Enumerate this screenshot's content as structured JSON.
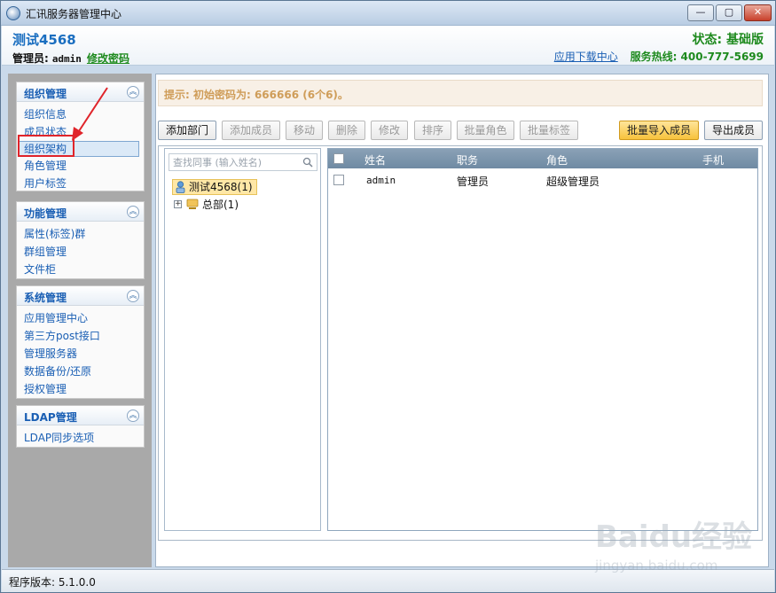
{
  "window": {
    "title": "汇讯服务器管理中心",
    "min_glyph": "—",
    "max_glyph": "▢",
    "close_glyph": "✕"
  },
  "header": {
    "org_name": "测试4568",
    "admin_label": "管理员:",
    "admin_name": "admin",
    "change_password": "修改密码",
    "status": "状态: 基础版",
    "download": "应用下载中心",
    "hotline": "服务热线: 400-777-5699"
  },
  "sidebar": {
    "panels": [
      {
        "title": "组织管理",
        "items": [
          "组织信息",
          "成员状态",
          "组织架构",
          "角色管理",
          "用户标签"
        ]
      },
      {
        "title": "功能管理",
        "items": [
          "属性(标签)群",
          "群组管理",
          "文件柜"
        ]
      },
      {
        "title": "系统管理",
        "items": [
          "应用管理中心",
          "第三方post接口",
          "管理服务器",
          "数据备份/还原",
          "授权管理"
        ]
      },
      {
        "title": "LDAP管理",
        "items": [
          "LDAP同步选项"
        ]
      }
    ],
    "collapse_glyph": "︽",
    "active_item": "组织架构"
  },
  "main": {
    "hint": "提示: 初始密码为: 666666 (6个6)。",
    "toolbar": {
      "add_dept": "添加部门",
      "add_member": "添加成员",
      "move": "移动",
      "delete": "删除",
      "edit": "修改",
      "sort": "排序",
      "batch_role": "批量角色",
      "batch_tag": "批量标签",
      "batch_import": "批量导入成员",
      "export": "导出成员"
    },
    "search": {
      "placeholder": "查找同事 (输入姓名)"
    },
    "tree": {
      "root": "测试4568(1)",
      "child": "总部(1)",
      "expand_glyph": "+"
    },
    "table": {
      "columns": [
        "姓名",
        "职务",
        "角色",
        "手机"
      ],
      "rows": [
        {
          "name": "admin",
          "title": "管理员",
          "role": "超级管理员",
          "phone": ""
        }
      ]
    }
  },
  "statusbar": {
    "version": "程序版本: 5.1.0.0"
  },
  "watermark": {
    "text": "Baidu经验",
    "url": "jingyan.baidu.com"
  },
  "colors": {
    "link_blue": "#1a5fb4",
    "green": "#1e8a1e",
    "hint_text": "#cf9d59",
    "highlight_red": "#e0242a",
    "table_header": "#7a93aa"
  }
}
